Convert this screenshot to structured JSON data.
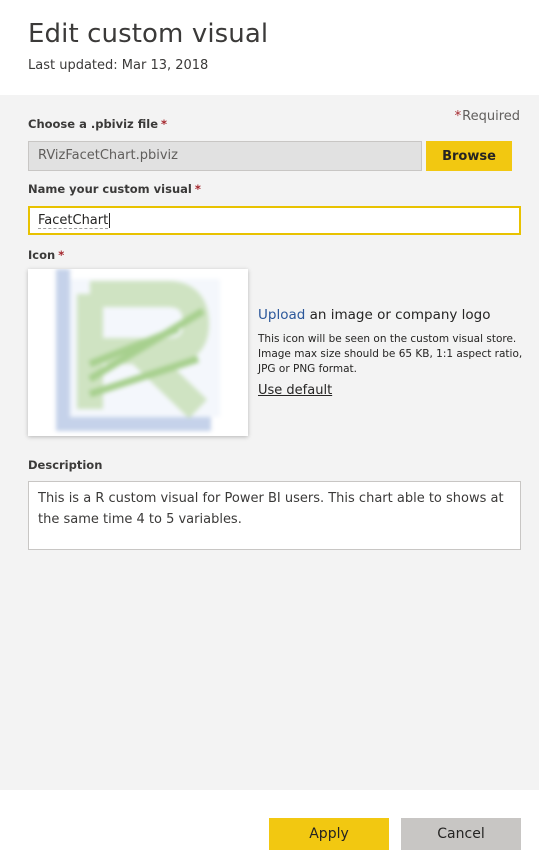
{
  "header": {
    "title": "Edit custom visual",
    "last_updated": "Last updated: Mar 13, 2018"
  },
  "form": {
    "required_star": "*",
    "required_label": "Required",
    "file": {
      "label": "Choose a .pbiviz file",
      "value": "RVizFacetChart.pbiviz",
      "browse_label": "Browse"
    },
    "name": {
      "label": "Name your custom visual",
      "value": "FacetChart"
    },
    "icon": {
      "label": "Icon",
      "upload_link": "Upload",
      "upload_rest": " an image or company logo",
      "help": "This icon will be seen on the custom visual store. Image max size should be 65 KB, 1:1 aspect ratio, JPG or PNG format.",
      "use_default": "Use default",
      "preview_icon": "blurred-r-letter-icon"
    },
    "description": {
      "label": "Description",
      "value": "This is a R custom visual for Power BI users. This chart able to shows at the same time 4 to 5 variables."
    }
  },
  "footer": {
    "apply_label": "Apply",
    "cancel_label": "Cancel"
  },
  "colors": {
    "accent": "#f2c811",
    "required_star": "#a4262c",
    "link": "#2b579a",
    "cancel": "#c8c6c4",
    "panel_bg": "#f3f3f3"
  }
}
